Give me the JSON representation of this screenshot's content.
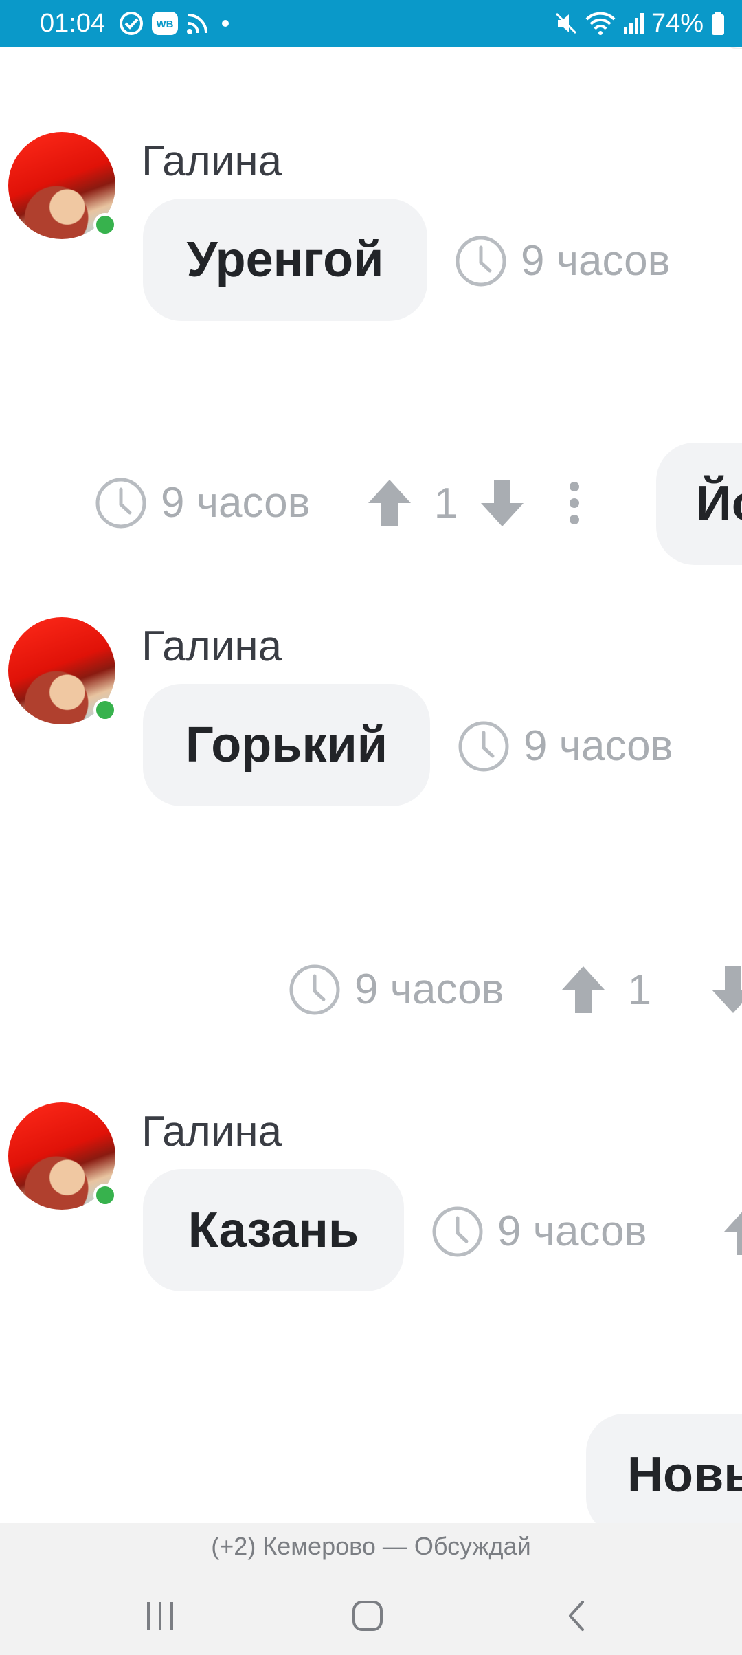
{
  "status_bar": {
    "time": "01:04",
    "battery": "74%",
    "icons_left": [
      "sync-check-icon",
      "wb-app-icon",
      "cast-icon",
      "dot-icon"
    ],
    "icons_right": [
      "mute-icon",
      "wifi-icon",
      "signal-icon",
      "battery-icon"
    ]
  },
  "messages": [
    {
      "author": "Галина",
      "text": "Уренгой",
      "time": "9 часов",
      "online": true
    },
    {
      "outgoing": true,
      "time": "9 часов",
      "votes": "1",
      "text": "Йо"
    },
    {
      "author": "Галина",
      "text": "Горький",
      "time": "9 часов",
      "online": true
    },
    {
      "outgoing": true,
      "time": "9 часов",
      "votes": "1"
    },
    {
      "author": "Галина",
      "text": "Казань",
      "time": "9 часов",
      "online": true
    },
    {
      "outgoing": true,
      "text": "Новы"
    }
  ],
  "bottom": {
    "title": "(+2) Кемерово — Обсуждай"
  },
  "colors": {
    "status_bar": "#0a99c9",
    "bubble": "#f2f3f5",
    "meta": "#a9adb2",
    "online": "#37b24d"
  }
}
